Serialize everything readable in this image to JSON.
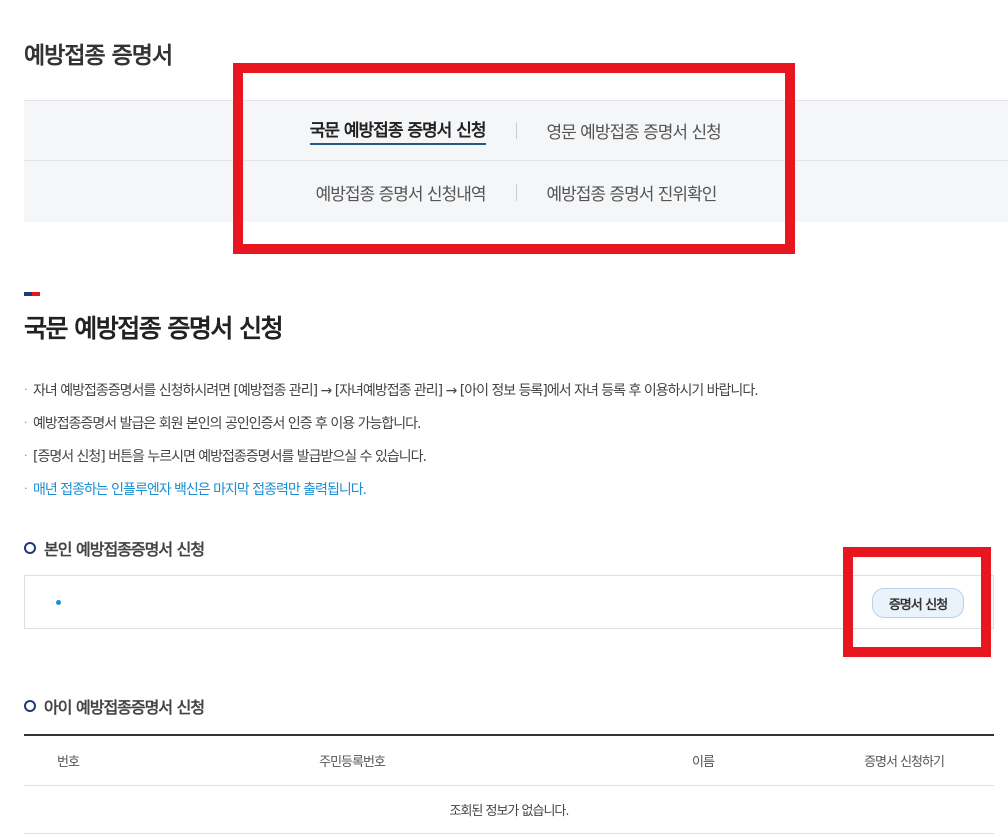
{
  "page": {
    "title": "예방접종 증명서"
  },
  "tabs": {
    "row1": [
      {
        "label": "국문 예방접종 증명서 신청",
        "active": true
      },
      {
        "label": "영문 예방접종 증명서 신청",
        "active": false
      }
    ],
    "row2": [
      {
        "label": "예방접종 증명서 신청내역",
        "active": false
      },
      {
        "label": "예방접종 증명서 진위확인",
        "active": false
      }
    ]
  },
  "section": {
    "title": "국문 예방접종 증명서 신청"
  },
  "notices": [
    "자녀 예방접종증명서를 신청하시려면 [예방접종 관리] → [자녀예방접종 관리] → [아이 정보 등록]에서 자녀 등록 후 이용하시기 바랍니다.",
    "예방접종증명서 발급은 회원 본인의 공인인증서 인증 후 이용 가능합니다.",
    "[증명서 신청] 버튼을 누르시면 예방접종증명서를 발급받으실 수 있습니다.",
    "매년 접종하는 인플루엔자 백신은 마지막 접종력만 출력됩니다."
  ],
  "self_section": {
    "heading": "본인 예방접종증명서 신청",
    "button_label": "증명서 신청"
  },
  "child_section": {
    "heading": "아이 예방접종증명서 신청",
    "columns": [
      "번호",
      "주민등록번호",
      "이름",
      "증명서 신청하기"
    ],
    "empty_message": "조회된 정보가 없습니다."
  },
  "colors": {
    "highlight": "#e8161f",
    "active_underline": "#1f5a8a",
    "notice_blue": "#1a8fd4",
    "accent_navy": "#1e3a78"
  }
}
